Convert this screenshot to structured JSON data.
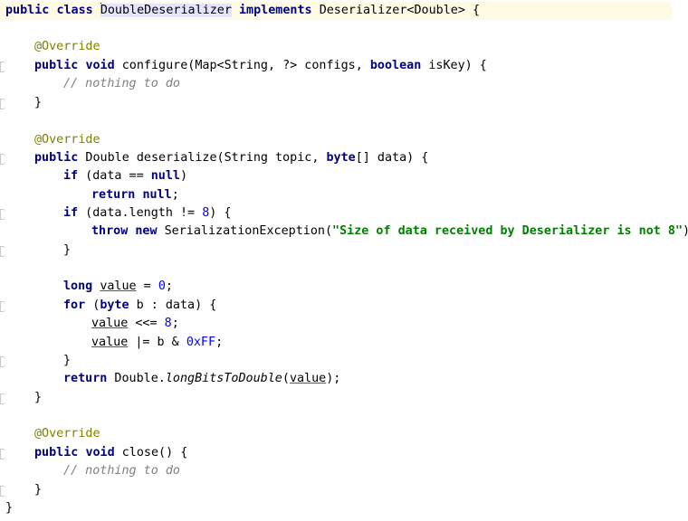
{
  "code": {
    "class_decl": {
      "kw1": "public",
      "kw2": "class",
      "name": "DoubleDeserializer",
      "kw3": "implements",
      "iface": "Deserializer<Double> {"
    },
    "override": "@Override",
    "configure": {
      "kw1": "public",
      "kw2": "void",
      "sig1": " configure(Map<String, ?> configs, ",
      "kw3": "boolean",
      "sig2": " isKey) {",
      "comment": "// nothing to do",
      "close": "}"
    },
    "deserialize": {
      "kw1": "public",
      "sig1": " Double deserialize(String topic, ",
      "kw2": "byte",
      "sig2": "[] data) {",
      "if1_kw": "if",
      "if1_a": " (data == ",
      "null": "null",
      "if1_b": ")",
      "ret_kw": "return",
      "ret_null": "null",
      "semi": ";",
      "if2_kw": "if",
      "if2_a": " (data.length != ",
      "eight": "8",
      "if2_b": ") {",
      "throw_kw": "throw",
      "new_kw": "new",
      "exc": " SerializationException(",
      "msg": "\"Size of data received by Deserializer is not 8\"",
      "exc_end": ");",
      "brace": "}",
      "long_kw": "long",
      "value": "value",
      "assign": " = ",
      "zero": "0",
      "for_kw": "for",
      "for_a": " (",
      "byte_kw": "byte",
      "for_b": " b : data) {",
      "shift_op": " <<= ",
      "or_op": " |= b & ",
      "hex": "0xFF",
      "ret2_kw": "return",
      "ret2_a": " Double.",
      "method": "longBitsToDouble",
      "ret2_b": "(",
      "ret2_c": ");",
      "close": "}"
    },
    "close_method": {
      "kw1": "public",
      "kw2": "void",
      "sig": " close() {",
      "comment": "// nothing to do",
      "close": "}"
    },
    "class_close": "}"
  }
}
